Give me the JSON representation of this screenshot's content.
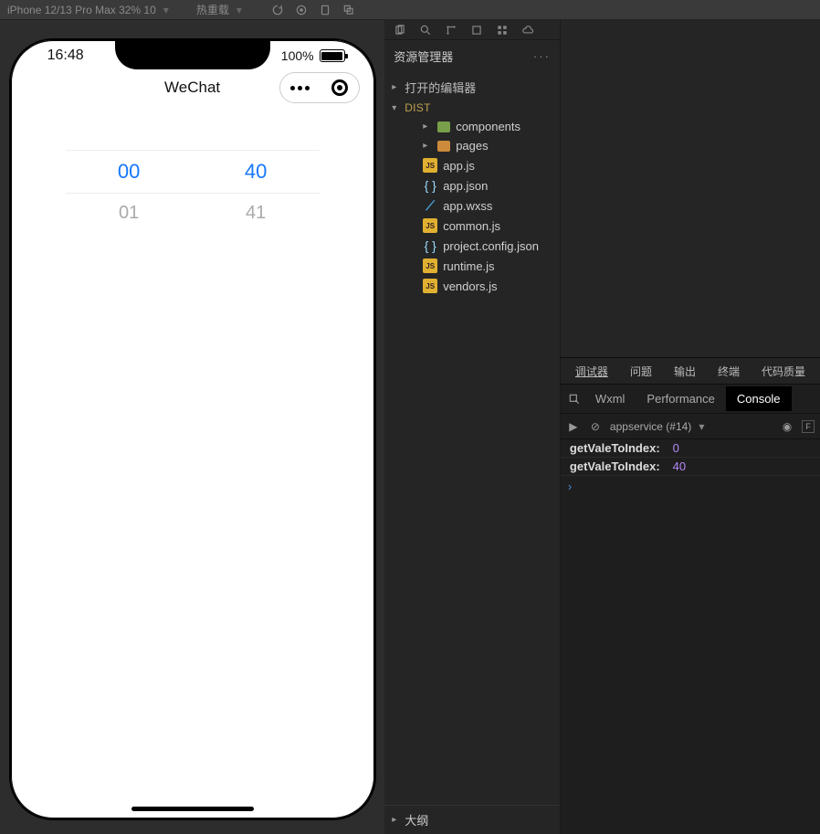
{
  "toolbar": {
    "device_label": "iPhone 12/13 Pro Max 32% 10",
    "compile_label": "热重载"
  },
  "simulator": {
    "status_time": "16:48",
    "battery_text": "100%",
    "nav_title": "WeChat",
    "picker_active": [
      "00",
      "40"
    ],
    "picker_next": [
      "01",
      "41"
    ]
  },
  "explorer": {
    "title": "资源管理器",
    "open_editors": "打开的编辑器",
    "root_folder": "DIST",
    "folders": [
      {
        "name": "components",
        "icon": "comp"
      },
      {
        "name": "pages",
        "icon": "folder"
      }
    ],
    "files": [
      {
        "name": "app.js",
        "icon": "js"
      },
      {
        "name": "app.json",
        "icon": "json"
      },
      {
        "name": "app.wxss",
        "icon": "wxss"
      },
      {
        "name": "common.js",
        "icon": "js"
      },
      {
        "name": "project.config.json",
        "icon": "json"
      },
      {
        "name": "runtime.js",
        "icon": "js"
      },
      {
        "name": "vendors.js",
        "icon": "js"
      }
    ],
    "outline": "大纲"
  },
  "devtools": {
    "outer_tabs": [
      "调试器",
      "问题",
      "输出",
      "终端",
      "代码质量"
    ],
    "inner_tabs": [
      "Wxml",
      "Performance",
      "Console"
    ],
    "inner_active": "Console",
    "context": "appservice (#14)",
    "lines": [
      {
        "key": "getValeToIndex:",
        "val": "0"
      },
      {
        "key": "getValeToIndex:",
        "val": "40"
      }
    ],
    "prompt": "›"
  }
}
